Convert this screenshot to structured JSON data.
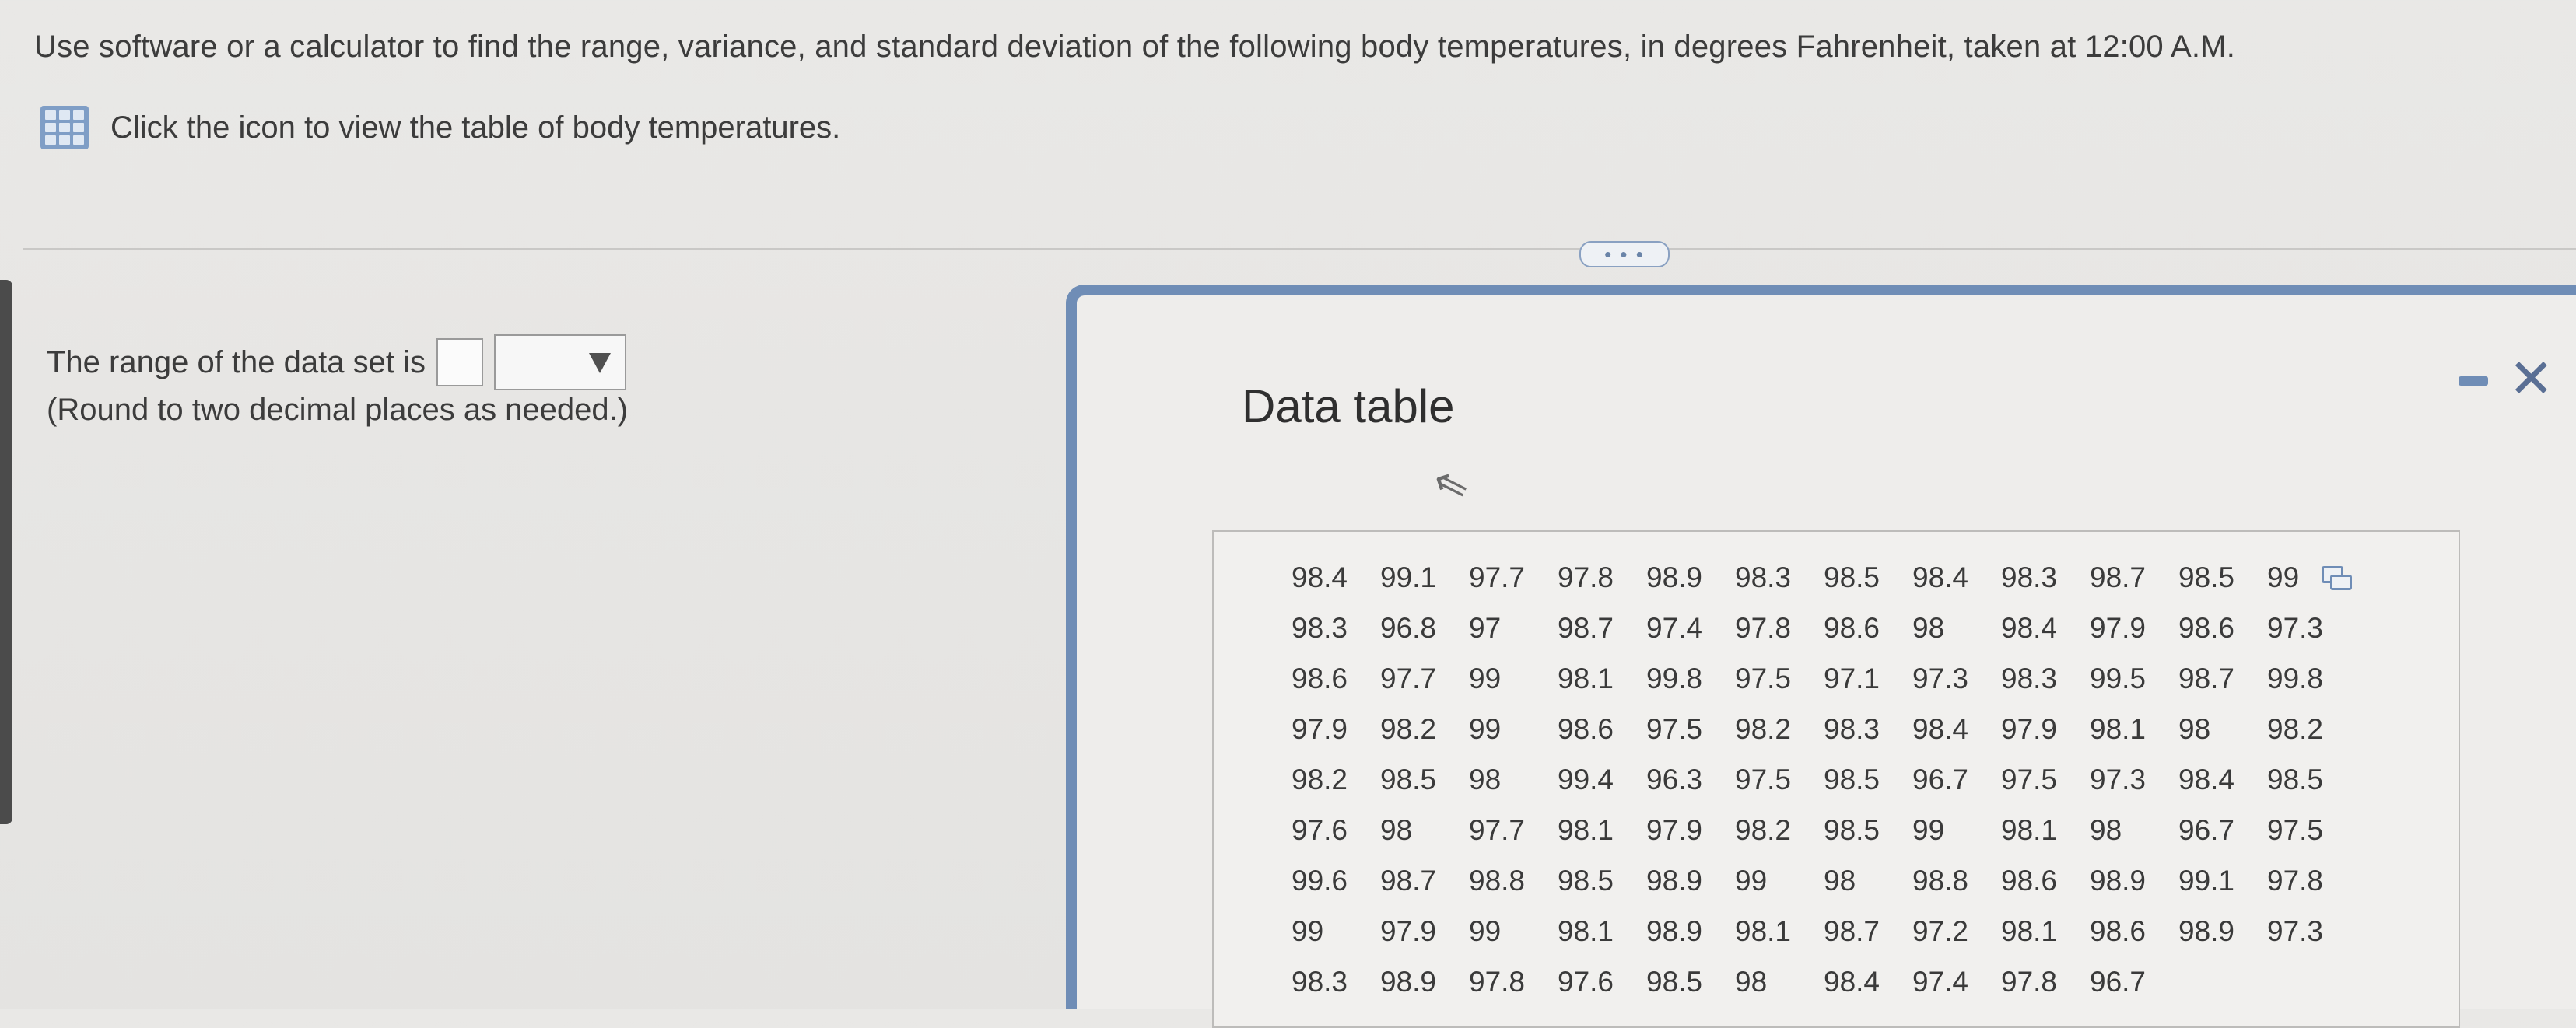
{
  "question": {
    "text": "Use software or a calculator to find the range, variance, and standard deviation of the following body temperatures, in degrees Fahrenheit, taken at 12:00 A.M."
  },
  "table_link": {
    "icon": "table-grid-icon",
    "text": "Click the icon to view the table of body temperatures."
  },
  "answer": {
    "prompt": "The range of the data set is",
    "value": "",
    "unit_selected": "",
    "note": "(Round to two decimal places as needed.)"
  },
  "dialog": {
    "title": "Data table",
    "minimize_icon": "minimize-icon",
    "close_label": "✕",
    "rows": [
      [
        "98.4",
        "99.1",
        "97.7",
        "97.8",
        "98.9",
        "98.3",
        "98.5",
        "98.4",
        "98.3",
        "98.7",
        "98.5",
        "99"
      ],
      [
        "98.3",
        "96.8",
        "97",
        "98.7",
        "97.4",
        "97.8",
        "98.6",
        "98",
        "98.4",
        "97.9",
        "98.6",
        "97.3"
      ],
      [
        "98.6",
        "97.7",
        "99",
        "98.1",
        "99.8",
        "97.5",
        "97.1",
        "97.3",
        "98.3",
        "99.5",
        "98.7",
        "99.8"
      ],
      [
        "97.9",
        "98.2",
        "99",
        "98.6",
        "97.5",
        "98.2",
        "98.3",
        "98.4",
        "97.9",
        "98.1",
        "98",
        "98.2"
      ],
      [
        "98.2",
        "98.5",
        "98",
        "99.4",
        "96.3",
        "97.5",
        "98.5",
        "96.7",
        "97.5",
        "97.3",
        "98.4",
        "98.5"
      ],
      [
        "97.6",
        "98",
        "97.7",
        "98.1",
        "97.9",
        "98.2",
        "98.5",
        "99",
        "98.1",
        "98",
        "96.7",
        "97.5"
      ],
      [
        "99.6",
        "98.7",
        "98.8",
        "98.5",
        "98.9",
        "99",
        "98",
        "98.8",
        "98.6",
        "98.9",
        "99.1",
        "97.8"
      ],
      [
        "99",
        "97.9",
        "99",
        "98.1",
        "98.9",
        "98.1",
        "98.7",
        "97.2",
        "98.1",
        "98.6",
        "98.9",
        "97.3"
      ],
      [
        "98.3",
        "98.9",
        "97.8",
        "97.6",
        "98.5",
        "98",
        "98.4",
        "97.4",
        "97.8",
        "96.7"
      ]
    ]
  }
}
